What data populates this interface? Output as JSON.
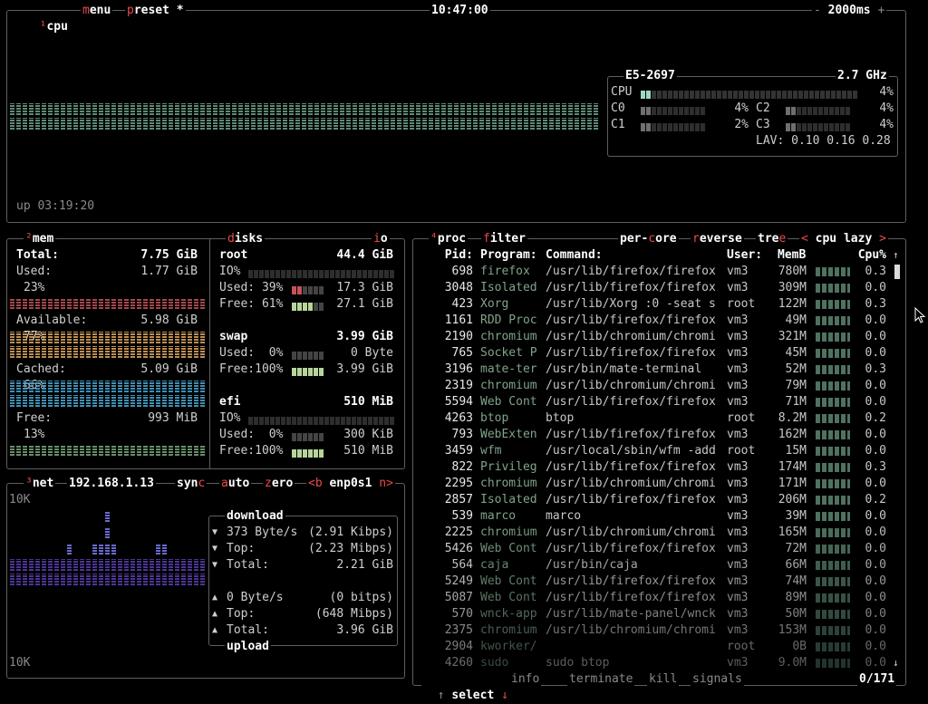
{
  "cpu": {
    "num": "¹",
    "title": "cpu",
    "menu_m": "m",
    "menu_rest": "enu",
    "preset_p": "p",
    "preset_rest": "reset",
    "preset_mark": "*",
    "clock": "10:47:00",
    "minus": "-",
    "interval": "2000ms",
    "plus": "+",
    "uptime": "up 03:19:20",
    "model": "E5-2697",
    "freq": "2.7 GHz",
    "total_label": "CPU",
    "total_pct": "4%",
    "cores": [
      {
        "label": "C0",
        "pct": "4%",
        "level": 0.04
      },
      {
        "label": "C1",
        "pct": "2%",
        "level": 0.02
      },
      {
        "label": "C2",
        "pct": "4%",
        "level": 0.04
      },
      {
        "label": "C3",
        "pct": "4%",
        "level": 0.04
      }
    ],
    "lav_label": "LAV:",
    "lav": "0.10 0.16 0.28",
    "color": "#6fa38a"
  },
  "mem": {
    "num": "²",
    "title": "mem",
    "total_label": "Total:",
    "total": "7.75 GiB",
    "used_label": "Used:",
    "used": "1.77 GiB",
    "used_pct": "23%",
    "avail_label": "Available:",
    "avail": "5.98 GiB",
    "avail_pct": "77%",
    "cached_label": "Cached:",
    "cached": "5.09 GiB",
    "cached_pct": "66%",
    "free_label": "Free:",
    "free": "993 MiB",
    "free_pct": "13%",
    "colors": {
      "used": "#c2545a",
      "avail": "#e0a860",
      "cached": "#4aaad6",
      "free": "#78a87a"
    }
  },
  "disks": {
    "d": "d",
    "title_rest": "isks",
    "io_i": "i",
    "io_rest": "o",
    "items": [
      {
        "name": "root",
        "size": "44.4 GiB",
        "io": "IO%",
        "used_label": "Used: 39%",
        "used": "17.3 GiB",
        "free_label": "Free: 61%",
        "free": "27.1 GiB"
      },
      {
        "name": "swap",
        "size": "3.99 GiB",
        "io": "",
        "used_label": "Used:  0%",
        "used": "0 Byte",
        "free_label": "Free:100%",
        "free": "3.99 GiB"
      },
      {
        "name": "efi",
        "size": "510 MiB",
        "io": "IO%",
        "used_label": "Used:  0%",
        "used": "300 KiB",
        "free_label": "Free:100%",
        "free": "510 MiB"
      }
    ]
  },
  "net": {
    "num": "³",
    "title": "net",
    "ip": "192.168.1.13",
    "sync_pre": "syn",
    "sync_c": "c",
    "auto_a": "a",
    "auto_rest": "uto",
    "zero_z": "z",
    "zero_rest": "ero",
    "b": "<b",
    "iface": "enp0s1",
    "n": "n>",
    "scale_top": "10K",
    "scale_bottom": "10K",
    "download_title": "download",
    "dl_rate": "373 Byte/s",
    "dl_bits": "(2.91 Kibps)",
    "dl_top_label": "Top:",
    "dl_top": "(2.23 Mibps)",
    "dl_total_label": "Total:",
    "dl_total": "2.21 GiB",
    "ul_rate": "0 Byte/s",
    "ul_bits": "(0 bitps)",
    "ul_top_label": "Top:",
    "ul_top": "(648 Mibps)",
    "ul_total_label": "Total:",
    "ul_total": "3.96 GiB",
    "upload_title": "upload",
    "down_arrow": "▼",
    "up_arrow": "▲"
  },
  "proc": {
    "num": "⁴",
    "title": "proc",
    "filter_f": "f",
    "filter_rest": "ilter",
    "percore_a": "per-",
    "percore_c": "c",
    "percore_b": "ore",
    "reverse_r": "r",
    "reverse_rest": "everse",
    "tree_a": "tre",
    "tree_e": "e",
    "sort_left": "<",
    "sort": "cpu lazy",
    "sort_right": ">",
    "headers": {
      "pid": "Pid:",
      "program": "Program:",
      "command": "Command:",
      "user": "User:",
      "mem": "MemB",
      "cpu": "Cpu%"
    },
    "rows": [
      {
        "pid": "698",
        "program": "firefox",
        "command": "/usr/lib/firefox/firefox",
        "user": "vm3",
        "mem": "780M",
        "cpu": "0.3"
      },
      {
        "pid": "3048",
        "program": "Isolated",
        "command": "/usr/lib/firefox/firefox",
        "user": "vm3",
        "mem": "309M",
        "cpu": "0.0"
      },
      {
        "pid": "423",
        "program": "Xorg",
        "command": "/usr/lib/Xorg :0 -seat s",
        "user": "root",
        "mem": "122M",
        "cpu": "0.3"
      },
      {
        "pid": "1161",
        "program": "RDD Proc",
        "command": "/usr/lib/firefox/firefox",
        "user": "vm3",
        "mem": "49M",
        "cpu": "0.0"
      },
      {
        "pid": "2190",
        "program": "chromium",
        "command": "/usr/lib/chromium/chromi",
        "user": "vm3",
        "mem": "321M",
        "cpu": "0.0"
      },
      {
        "pid": "765",
        "program": "Socket P",
        "command": "/usr/lib/firefox/firefox",
        "user": "vm3",
        "mem": "45M",
        "cpu": "0.0"
      },
      {
        "pid": "3196",
        "program": "mate-ter",
        "command": "/usr/bin/mate-terminal",
        "user": "vm3",
        "mem": "52M",
        "cpu": "0.3"
      },
      {
        "pid": "2319",
        "program": "chromium",
        "command": "/usr/lib/chromium/chromi",
        "user": "vm3",
        "mem": "79M",
        "cpu": "0.0"
      },
      {
        "pid": "5594",
        "program": "Web Cont",
        "command": "/usr/lib/firefox/firefox",
        "user": "vm3",
        "mem": "71M",
        "cpu": "0.0"
      },
      {
        "pid": "4263",
        "program": "btop",
        "command": "btop",
        "user": "root",
        "mem": "8.2M",
        "cpu": "0.2"
      },
      {
        "pid": "793",
        "program": "WebExten",
        "command": "/usr/lib/firefox/firefox",
        "user": "vm3",
        "mem": "162M",
        "cpu": "0.0"
      },
      {
        "pid": "3459",
        "program": "wfm",
        "command": "/usr/local/sbin/wfm -add",
        "user": "root",
        "mem": "15M",
        "cpu": "0.0"
      },
      {
        "pid": "822",
        "program": "Privileg",
        "command": "/usr/lib/firefox/firefox",
        "user": "vm3",
        "mem": "174M",
        "cpu": "0.3"
      },
      {
        "pid": "2295",
        "program": "chromium",
        "command": "/usr/lib/chromium/chromi",
        "user": "vm3",
        "mem": "171M",
        "cpu": "0.0"
      },
      {
        "pid": "2857",
        "program": "Isolated",
        "command": "/usr/lib/firefox/firefox",
        "user": "vm3",
        "mem": "206M",
        "cpu": "0.2"
      },
      {
        "pid": "539",
        "program": "marco",
        "command": "marco",
        "user": "vm3",
        "mem": "39M",
        "cpu": "0.0"
      },
      {
        "pid": "2225",
        "program": "chromium",
        "command": "/usr/lib/chromium/chromi",
        "user": "vm3",
        "mem": "165M",
        "cpu": "0.0"
      },
      {
        "pid": "5426",
        "program": "Web Cont",
        "command": "/usr/lib/firefox/firefox",
        "user": "vm3",
        "mem": "72M",
        "cpu": "0.0"
      },
      {
        "pid": "564",
        "program": "caja",
        "command": "/usr/bin/caja",
        "user": "vm3",
        "mem": "66M",
        "cpu": "0.0"
      },
      {
        "pid": "5249",
        "program": "Web Cont",
        "command": "/usr/lib/firefox/firefox",
        "user": "vm3",
        "mem": "74M",
        "cpu": "0.0"
      },
      {
        "pid": "5087",
        "program": "Web Cont",
        "command": "/usr/lib/firefox/firefox",
        "user": "vm3",
        "mem": "89M",
        "cpu": "0.0"
      },
      {
        "pid": "570",
        "program": "wnck-app",
        "command": "/usr/lib/mate-panel/wnck",
        "user": "vm3",
        "mem": "50M",
        "cpu": "0.0"
      },
      {
        "pid": "2375",
        "program": "chromium",
        "command": "/usr/lib/chromium/chromi",
        "user": "vm3",
        "mem": "153M",
        "cpu": "0.0"
      },
      {
        "pid": "2904",
        "program": "kworker/",
        "command": "",
        "user": "root",
        "mem": "0B",
        "cpu": "0.0"
      },
      {
        "pid": "4260",
        "program": "sudo",
        "command": "sudo btop",
        "user": "vm3",
        "mem": "9.0M",
        "cpu": "0.0"
      }
    ],
    "footer": {
      "up": "↑",
      "select": "select",
      "down": "↓",
      "info_i": "i",
      "info_rest": "nfo",
      "terminate_t": "t",
      "terminate_rest": "erminate",
      "kill_k": "k",
      "kill_rest": "ill",
      "signals_s": "s",
      "signals_rest": "ignals",
      "count": "0/171"
    },
    "scroll_up": "↑",
    "scroll_down": "↓"
  }
}
